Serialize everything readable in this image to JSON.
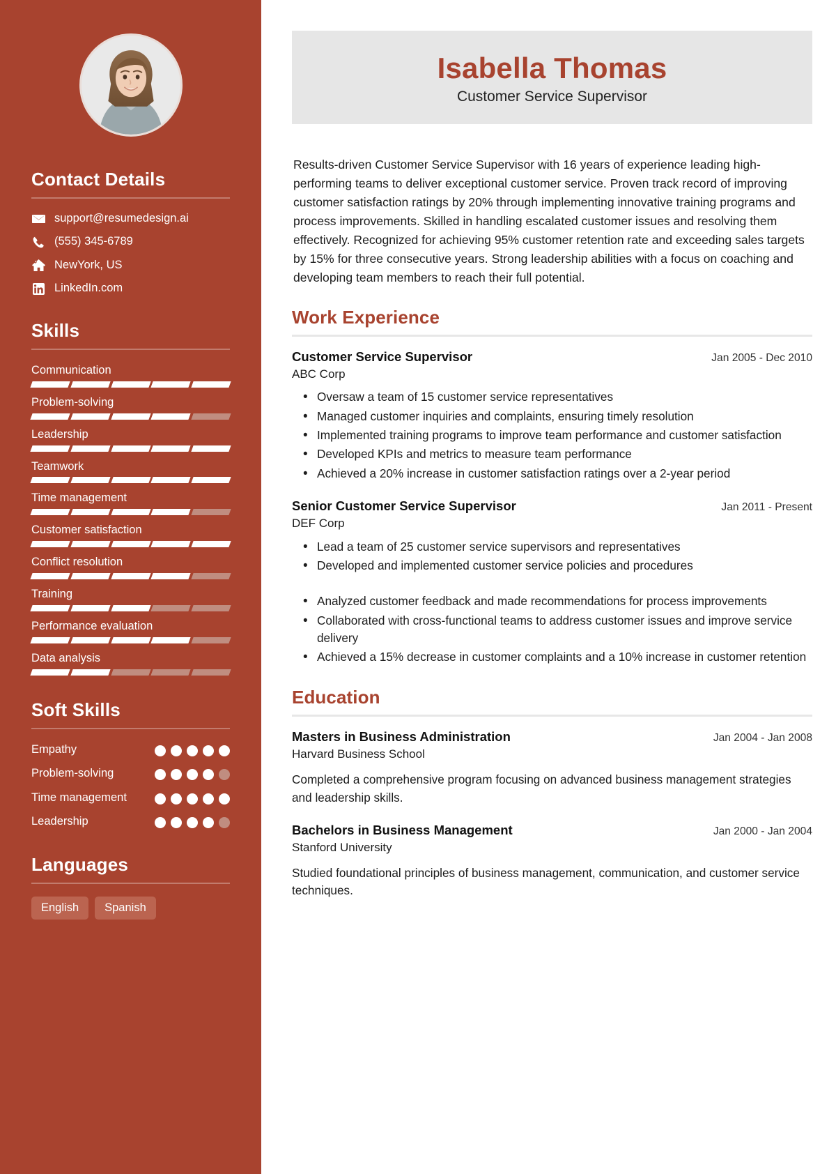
{
  "sidebar": {
    "avatar_alt": "profile-photo",
    "contact": {
      "heading": "Contact Details",
      "items": [
        {
          "icon": "email-icon",
          "value": "support@resumedesign.ai"
        },
        {
          "icon": "phone-icon",
          "value": "(555) 345-6789"
        },
        {
          "icon": "home-icon",
          "value": "NewYork, US"
        },
        {
          "icon": "linkedin-icon",
          "value": "LinkedIn.com"
        }
      ]
    },
    "skills": {
      "heading": "Skills",
      "max": 5,
      "items": [
        {
          "label": "Communication",
          "level": 5
        },
        {
          "label": "Problem-solving",
          "level": 4
        },
        {
          "label": "Leadership",
          "level": 5
        },
        {
          "label": "Teamwork",
          "level": 5
        },
        {
          "label": "Time management",
          "level": 4
        },
        {
          "label": "Customer satisfaction",
          "level": 5
        },
        {
          "label": "Conflict resolution",
          "level": 4
        },
        {
          "label": "Training",
          "level": 3
        },
        {
          "label": "Performance evaluation",
          "level": 4
        },
        {
          "label": "Data analysis",
          "level": 2
        }
      ]
    },
    "soft_skills": {
      "heading": "Soft Skills",
      "max": 5,
      "items": [
        {
          "label": "Empathy",
          "level": 5
        },
        {
          "label": "Problem-solving",
          "level": 4
        },
        {
          "label": "Time management",
          "level": 5
        },
        {
          "label": "Leadership",
          "level": 4
        }
      ]
    },
    "languages": {
      "heading": "Languages",
      "items": [
        "English",
        "Spanish"
      ]
    }
  },
  "main": {
    "name": "Isabella Thomas",
    "job_title": "Customer Service Supervisor",
    "summary": "Results-driven Customer Service Supervisor with 16 years of experience leading high-performing teams to deliver exceptional customer service. Proven track record of improving customer satisfaction ratings by 20% through implementing innovative training programs and process improvements. Skilled in handling escalated customer issues and resolving them effectively. Recognized for achieving 95% customer retention rate and exceeding sales targets by 15% for three consecutive years. Strong leadership abilities with a focus on coaching and developing team members to reach their full potential.",
    "work": {
      "heading": "Work Experience",
      "entries": [
        {
          "title": "Customer Service Supervisor",
          "org": "ABC Corp",
          "date": "Jan 2005 - Dec 2010",
          "bullets": [
            "Oversaw a team of 15 customer service representatives",
            "Managed customer inquiries and complaints, ensuring timely resolution",
            "Implemented training programs to improve team performance and customer satisfaction",
            "Developed KPIs and metrics to measure team performance",
            "Achieved a 20% increase in customer satisfaction ratings over a 2-year period"
          ]
        },
        {
          "title": "Senior Customer Service Supervisor",
          "org": "DEF Corp",
          "date": "Jan 2011 - Present",
          "bullets": [
            "Lead a team of 25 customer service supervisors and representatives",
            "Developed and implemented customer service policies and procedures",
            "",
            "Analyzed customer feedback and made recommendations for process improvements",
            "Collaborated with cross-functional teams to address customer issues and improve service delivery",
            "Achieved a 15% decrease in customer complaints and a 10% increase in customer retention"
          ]
        }
      ]
    },
    "education": {
      "heading": "Education",
      "entries": [
        {
          "title": "Masters in Business Administration",
          "org": "Harvard Business School",
          "date": "Jan 2004 - Jan 2008",
          "desc": "Completed a comprehensive program focusing on advanced business management strategies and leadership skills."
        },
        {
          "title": "Bachelors in Business Management",
          "org": "Stanford University",
          "date": "Jan 2000 - Jan 2004",
          "desc": "Studied foundational principles of business management, communication, and customer service techniques."
        }
      ]
    }
  },
  "colors": {
    "accent": "#a8432f",
    "sidebar_bg": "#a8432f",
    "band_bg": "#e6e6e6",
    "bar_off": "#c08d80",
    "tag_bg": "#bb6450"
  }
}
